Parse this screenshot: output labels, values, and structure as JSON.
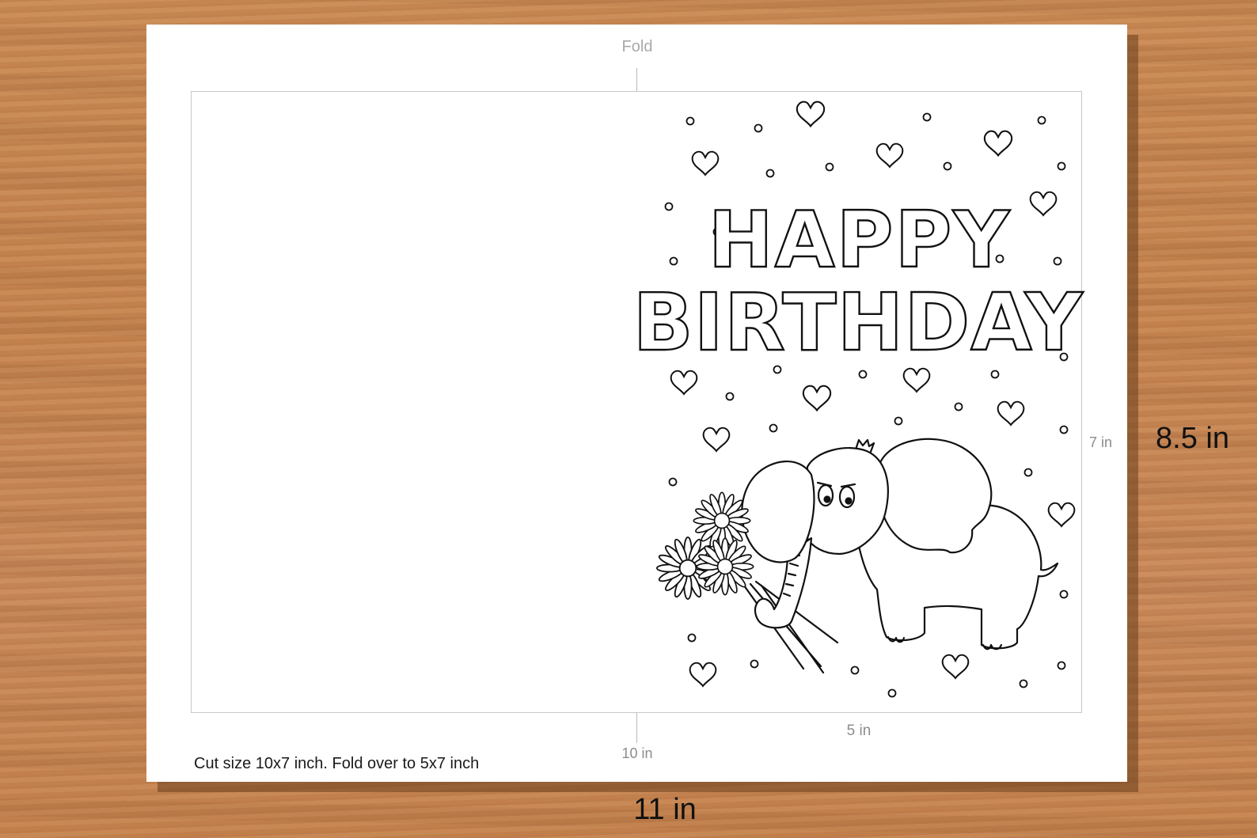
{
  "labels": {
    "fold": "Fold",
    "width_card": "10 in",
    "width_half": "5 in",
    "height_card": "7 in",
    "paper_height": "8.5 in",
    "paper_width": "11 in",
    "cut_note": "Cut size 10x7 inch. Fold over to 5x7 inch"
  },
  "card": {
    "line1": "HAPPY",
    "line2": "BIRTHDAY",
    "illustration": "elephant-holding-daisies"
  },
  "colors": {
    "wood": "#c68551",
    "paper": "#ffffff",
    "ink": "#111111"
  }
}
